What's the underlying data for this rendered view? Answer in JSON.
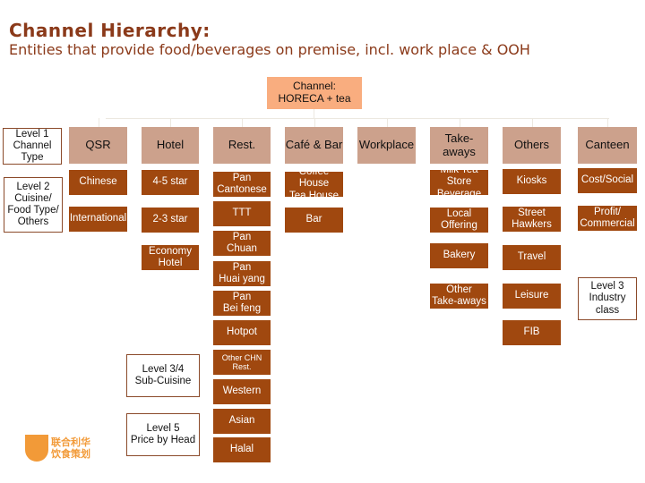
{
  "title": "Channel Hierarchy:",
  "subtitle": "Entities that provide food/beverages on premise, incl. work place & OOH",
  "root": "Channel:\nHORECA + tea",
  "legend": {
    "level1": "Level 1\nChannel Type",
    "level2": "Level 2\nCuisine/\nFood Type/\nOthers",
    "level3": "Level 3\nIndustry\nclass",
    "level34": "Level 3/4\nSub-Cuisine",
    "level5": "Level 5\nPrice by Head"
  },
  "columns": [
    {
      "label": "QSR",
      "items": [
        "Chinese",
        "International"
      ]
    },
    {
      "label": "Hotel",
      "items": [
        "4-5 star",
        "2-3 star",
        "Economy Hotel"
      ]
    },
    {
      "label": "Rest.",
      "items": [
        "Pan\nCantonese",
        "TTT",
        "Pan\nChuan",
        "Pan\nHuai yang",
        "Pan\nBei feng",
        "Hotpot",
        "Other CHN\nRest.",
        "Western",
        "Asian",
        "Halal"
      ]
    },
    {
      "label": "Café & Bar",
      "items": [
        "Coffee House\nTea House",
        "Bar"
      ]
    },
    {
      "label": "Workplace",
      "items": []
    },
    {
      "label": "Take-\naways",
      "items": [
        "Milk Tea Store\nBeverage",
        "Local Offering",
        "Bakery",
        "Other\nTake-aways"
      ]
    },
    {
      "label": "Others",
      "items": [
        "Kiosks",
        "Street\nHawkers",
        "Travel",
        "Leisure",
        "FIB"
      ]
    },
    {
      "label": "Canteen",
      "items": [
        "Cost/Social",
        "Profit/\nCommercial"
      ]
    }
  ],
  "logo": {
    "line1": "联合利华",
    "line2": "饮食策划"
  },
  "colors": {
    "root": "#f9ad7f",
    "level1": "#cca18c",
    "level2": "#a0480f",
    "title": "#8b3a1a",
    "logo": "#f29a38"
  }
}
